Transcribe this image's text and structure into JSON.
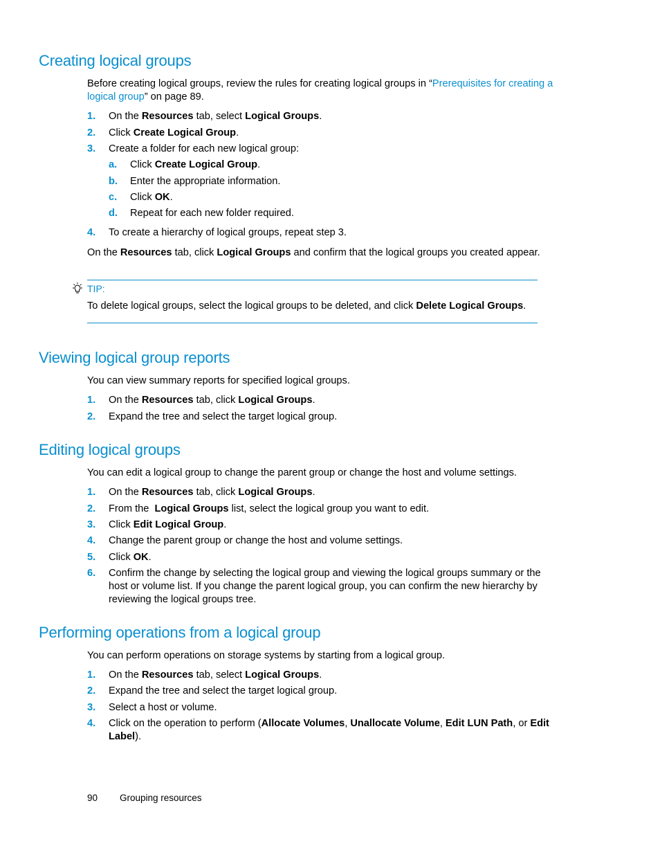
{
  "sections": {
    "creating": {
      "title": "Creating logical groups",
      "intro_before": "Before creating logical groups, review the rules for creating logical groups in “",
      "intro_link": "Prerequisites for creating a logical group",
      "intro_after": "” on page 89.",
      "steps": [
        {
          "num": "1.",
          "parts": [
            "On the ",
            "Resources",
            " tab, select ",
            "Logical Groups",
            "."
          ]
        },
        {
          "num": "2.",
          "parts": [
            "Click ",
            "Create Logical Group",
            "."
          ]
        },
        {
          "num": "3.",
          "text": "Create a folder for each new logical group:"
        },
        {
          "num": "4.",
          "text": "To create a hierarchy of logical groups, repeat step 3."
        }
      ],
      "substeps": [
        {
          "num": "a.",
          "parts": [
            "Click ",
            "Create Logical Group",
            "."
          ]
        },
        {
          "num": "b.",
          "text": "Enter the appropriate information."
        },
        {
          "num": "c.",
          "parts": [
            "Click ",
            "OK",
            "."
          ]
        },
        {
          "num": "d.",
          "text": "Repeat for each new folder required."
        }
      ],
      "closing_parts": [
        "On the ",
        "Resources",
        " tab, click ",
        "Logical Groups",
        " and confirm that the logical groups you created appear."
      ],
      "tip": {
        "icon": "lightbulb-icon",
        "label": "TIP:",
        "parts": [
          "To delete logical groups, select the logical groups to be deleted, and click ",
          "Delete Logical Groups",
          "."
        ]
      }
    },
    "viewing": {
      "title": "Viewing logical group reports",
      "intro": "You can view summary reports for specified logical groups.",
      "steps": [
        {
          "num": "1.",
          "parts": [
            "On the ",
            "Resources",
            " tab, click ",
            "Logical Groups",
            "."
          ]
        },
        {
          "num": "2.",
          "text": "Expand the tree and select the target logical group."
        }
      ]
    },
    "editing": {
      "title": "Editing logical groups",
      "intro": "You can edit a logical group to change the parent group or change the host and volume settings.",
      "steps": [
        {
          "num": "1.",
          "parts": [
            "On the ",
            "Resources",
            " tab, click ",
            "Logical Groups",
            "."
          ]
        },
        {
          "num": "2.",
          "parts": [
            "From the  ",
            "Logical Groups",
            " list, select the logical group you want to edit."
          ]
        },
        {
          "num": "3.",
          "parts": [
            "Click ",
            "Edit Logical Group",
            "."
          ]
        },
        {
          "num": "4.",
          "text": "Change the parent group or change the host and volume settings."
        },
        {
          "num": "5.",
          "parts": [
            "Click ",
            "OK",
            "."
          ]
        },
        {
          "num": "6.",
          "text": "Confirm the change by selecting the logical group and viewing the logical groups summary or the host or volume list. If you change the parent logical group, you can confirm the new hierarchy by reviewing the logical groups tree."
        }
      ]
    },
    "performing": {
      "title": "Performing operations from a logical group",
      "intro": "You can perform operations on storage systems by starting from a logical group.",
      "steps": [
        {
          "num": "1.",
          "parts": [
            "On the ",
            "Resources",
            " tab, select ",
            "Logical Groups",
            "."
          ]
        },
        {
          "num": "2.",
          "text": "Expand the tree and select the target logical group."
        },
        {
          "num": "3.",
          "text": "Select a host or volume."
        },
        {
          "num": "4.",
          "parts": [
            "Click on the operation to perform (",
            "Allocate Volumes",
            ", ",
            "Unallocate Volume",
            ", ",
            "Edit LUN Path",
            ", or ",
            "Edit Label",
            ")."
          ]
        }
      ]
    }
  },
  "footer": {
    "page_number": "90",
    "chapter": "Grouping resources"
  },
  "colors": {
    "accent": "#0a8fcf",
    "text": "#000000"
  }
}
